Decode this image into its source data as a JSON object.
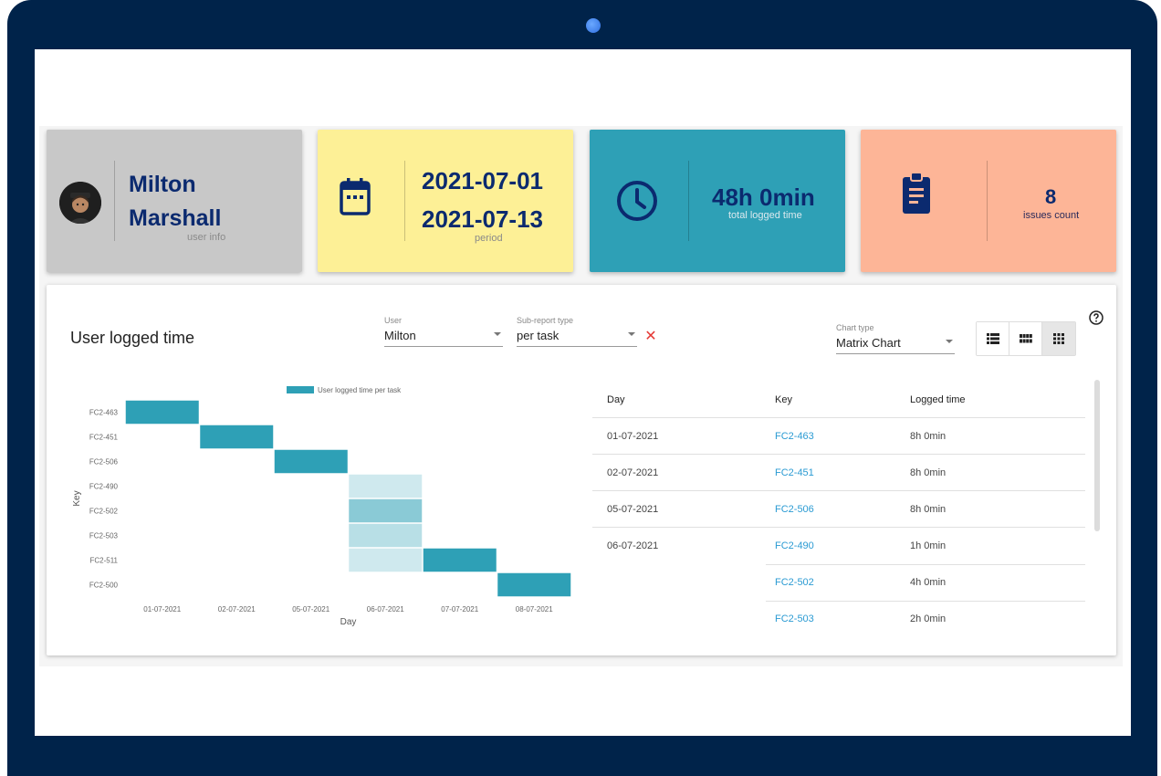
{
  "cards": {
    "user": {
      "first": "Milton",
      "last": "Marshall",
      "caption": "user info"
    },
    "period": {
      "from": "2021-07-01",
      "to": "2021-07-13",
      "caption": "period"
    },
    "time": {
      "value": "48h 0min",
      "caption": "total logged time"
    },
    "issues": {
      "value": "8",
      "caption": "issues count"
    }
  },
  "panel": {
    "title": "User logged time",
    "user_label": "User",
    "user_value": "Milton",
    "subtype_label": "Sub-report type",
    "subtype_value": "per task",
    "charttype_label": "Chart type",
    "charttype_value": "Matrix Chart"
  },
  "chart_data": {
    "type": "heatmap",
    "legend": "User logged time per task",
    "xlabel": "Day",
    "ylabel": "Key",
    "x": [
      "01-07-2021",
      "02-07-2021",
      "05-07-2021",
      "06-07-2021",
      "07-07-2021",
      "08-07-2021"
    ],
    "y": [
      "FC2-463",
      "FC2-451",
      "FC2-506",
      "FC2-490",
      "FC2-502",
      "FC2-503",
      "FC2-511",
      "FC2-500"
    ],
    "cells": [
      {
        "x": "01-07-2021",
        "y": "FC2-463",
        "value": 8
      },
      {
        "x": "02-07-2021",
        "y": "FC2-451",
        "value": 8
      },
      {
        "x": "05-07-2021",
        "y": "FC2-506",
        "value": 8
      },
      {
        "x": "06-07-2021",
        "y": "FC2-490",
        "value": 1
      },
      {
        "x": "06-07-2021",
        "y": "FC2-502",
        "value": 4
      },
      {
        "x": "06-07-2021",
        "y": "FC2-503",
        "value": 2
      },
      {
        "x": "06-07-2021",
        "y": "FC2-511",
        "value": 1
      },
      {
        "x": "07-07-2021",
        "y": "FC2-511",
        "value": 8
      },
      {
        "x": "08-07-2021",
        "y": "FC2-500",
        "value": 8
      }
    ],
    "color": "#2ea0b6"
  },
  "table": {
    "headers": [
      "Day",
      "Key",
      "Logged time"
    ],
    "rows": [
      {
        "day": "01-07-2021",
        "key": "FC2-463",
        "time": "8h 0min"
      },
      {
        "day": "02-07-2021",
        "key": "FC2-451",
        "time": "8h 0min"
      },
      {
        "day": "05-07-2021",
        "key": "FC2-506",
        "time": "8h 0min"
      },
      {
        "day": "06-07-2021",
        "key": "FC2-490",
        "time": "1h 0min"
      },
      {
        "day": "",
        "key": "FC2-502",
        "time": "4h 0min"
      },
      {
        "day": "",
        "key": "FC2-503",
        "time": "2h 0min"
      }
    ]
  }
}
